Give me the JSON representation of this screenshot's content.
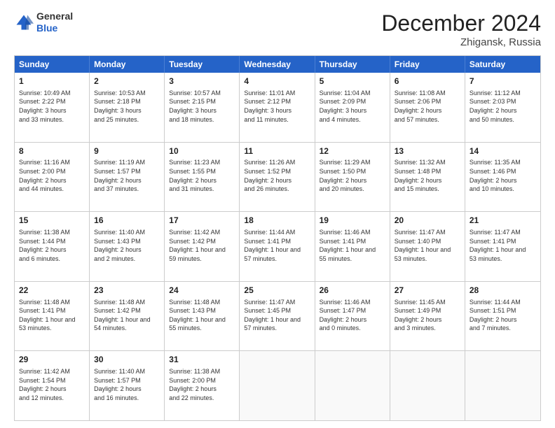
{
  "header": {
    "logo": {
      "line1": "General",
      "line2": "Blue"
    },
    "title": "December 2024",
    "subtitle": "Zhigansk, Russia"
  },
  "calendar": {
    "days_of_week": [
      "Sunday",
      "Monday",
      "Tuesday",
      "Wednesday",
      "Thursday",
      "Friday",
      "Saturday"
    ],
    "weeks": [
      [
        {
          "day": "",
          "empty": true
        },
        {
          "day": "",
          "empty": true
        },
        {
          "day": "",
          "empty": true
        },
        {
          "day": "",
          "empty": true
        },
        {
          "day": "",
          "empty": true
        },
        {
          "day": "",
          "empty": true
        },
        {
          "day": "",
          "empty": true
        }
      ]
    ],
    "cells": [
      [
        {
          "num": "1",
          "lines": [
            "Sunrise: 10:49 AM",
            "Sunset: 2:22 PM",
            "Daylight: 3 hours",
            "and 33 minutes."
          ]
        },
        {
          "num": "2",
          "lines": [
            "Sunrise: 10:53 AM",
            "Sunset: 2:18 PM",
            "Daylight: 3 hours",
            "and 25 minutes."
          ]
        },
        {
          "num": "3",
          "lines": [
            "Sunrise: 10:57 AM",
            "Sunset: 2:15 PM",
            "Daylight: 3 hours",
            "and 18 minutes."
          ]
        },
        {
          "num": "4",
          "lines": [
            "Sunrise: 11:01 AM",
            "Sunset: 2:12 PM",
            "Daylight: 3 hours",
            "and 11 minutes."
          ]
        },
        {
          "num": "5",
          "lines": [
            "Sunrise: 11:04 AM",
            "Sunset: 2:09 PM",
            "Daylight: 3 hours",
            "and 4 minutes."
          ]
        },
        {
          "num": "6",
          "lines": [
            "Sunrise: 11:08 AM",
            "Sunset: 2:06 PM",
            "Daylight: 2 hours",
            "and 57 minutes."
          ]
        },
        {
          "num": "7",
          "lines": [
            "Sunrise: 11:12 AM",
            "Sunset: 2:03 PM",
            "Daylight: 2 hours",
            "and 50 minutes."
          ]
        }
      ],
      [
        {
          "num": "8",
          "lines": [
            "Sunrise: 11:16 AM",
            "Sunset: 2:00 PM",
            "Daylight: 2 hours",
            "and 44 minutes."
          ]
        },
        {
          "num": "9",
          "lines": [
            "Sunrise: 11:19 AM",
            "Sunset: 1:57 PM",
            "Daylight: 2 hours",
            "and 37 minutes."
          ]
        },
        {
          "num": "10",
          "lines": [
            "Sunrise: 11:23 AM",
            "Sunset: 1:55 PM",
            "Daylight: 2 hours",
            "and 31 minutes."
          ]
        },
        {
          "num": "11",
          "lines": [
            "Sunrise: 11:26 AM",
            "Sunset: 1:52 PM",
            "Daylight: 2 hours",
            "and 26 minutes."
          ]
        },
        {
          "num": "12",
          "lines": [
            "Sunrise: 11:29 AM",
            "Sunset: 1:50 PM",
            "Daylight: 2 hours",
            "and 20 minutes."
          ]
        },
        {
          "num": "13",
          "lines": [
            "Sunrise: 11:32 AM",
            "Sunset: 1:48 PM",
            "Daylight: 2 hours",
            "and 15 minutes."
          ]
        },
        {
          "num": "14",
          "lines": [
            "Sunrise: 11:35 AM",
            "Sunset: 1:46 PM",
            "Daylight: 2 hours",
            "and 10 minutes."
          ]
        }
      ],
      [
        {
          "num": "15",
          "lines": [
            "Sunrise: 11:38 AM",
            "Sunset: 1:44 PM",
            "Daylight: 2 hours",
            "and 6 minutes."
          ]
        },
        {
          "num": "16",
          "lines": [
            "Sunrise: 11:40 AM",
            "Sunset: 1:43 PM",
            "Daylight: 2 hours",
            "and 2 minutes."
          ]
        },
        {
          "num": "17",
          "lines": [
            "Sunrise: 11:42 AM",
            "Sunset: 1:42 PM",
            "Daylight: 1 hour and",
            "59 minutes."
          ]
        },
        {
          "num": "18",
          "lines": [
            "Sunrise: 11:44 AM",
            "Sunset: 1:41 PM",
            "Daylight: 1 hour and",
            "57 minutes."
          ]
        },
        {
          "num": "19",
          "lines": [
            "Sunrise: 11:46 AM",
            "Sunset: 1:41 PM",
            "Daylight: 1 hour and",
            "55 minutes."
          ]
        },
        {
          "num": "20",
          "lines": [
            "Sunrise: 11:47 AM",
            "Sunset: 1:40 PM",
            "Daylight: 1 hour and",
            "53 minutes."
          ]
        },
        {
          "num": "21",
          "lines": [
            "Sunrise: 11:47 AM",
            "Sunset: 1:41 PM",
            "Daylight: 1 hour and",
            "53 minutes."
          ]
        }
      ],
      [
        {
          "num": "22",
          "lines": [
            "Sunrise: 11:48 AM",
            "Sunset: 1:41 PM",
            "Daylight: 1 hour and",
            "53 minutes."
          ]
        },
        {
          "num": "23",
          "lines": [
            "Sunrise: 11:48 AM",
            "Sunset: 1:42 PM",
            "Daylight: 1 hour and",
            "54 minutes."
          ]
        },
        {
          "num": "24",
          "lines": [
            "Sunrise: 11:48 AM",
            "Sunset: 1:43 PM",
            "Daylight: 1 hour and",
            "55 minutes."
          ]
        },
        {
          "num": "25",
          "lines": [
            "Sunrise: 11:47 AM",
            "Sunset: 1:45 PM",
            "Daylight: 1 hour and",
            "57 minutes."
          ]
        },
        {
          "num": "26",
          "lines": [
            "Sunrise: 11:46 AM",
            "Sunset: 1:47 PM",
            "Daylight: 2 hours",
            "and 0 minutes."
          ]
        },
        {
          "num": "27",
          "lines": [
            "Sunrise: 11:45 AM",
            "Sunset: 1:49 PM",
            "Daylight: 2 hours",
            "and 3 minutes."
          ]
        },
        {
          "num": "28",
          "lines": [
            "Sunrise: 11:44 AM",
            "Sunset: 1:51 PM",
            "Daylight: 2 hours",
            "and 7 minutes."
          ]
        }
      ],
      [
        {
          "num": "29",
          "lines": [
            "Sunrise: 11:42 AM",
            "Sunset: 1:54 PM",
            "Daylight: 2 hours",
            "and 12 minutes."
          ]
        },
        {
          "num": "30",
          "lines": [
            "Sunrise: 11:40 AM",
            "Sunset: 1:57 PM",
            "Daylight: 2 hours",
            "and 16 minutes."
          ]
        },
        {
          "num": "31",
          "lines": [
            "Sunrise: 11:38 AM",
            "Sunset: 2:00 PM",
            "Daylight: 2 hours",
            "and 22 minutes."
          ]
        },
        {
          "num": "",
          "empty": true,
          "lines": []
        },
        {
          "num": "",
          "empty": true,
          "lines": []
        },
        {
          "num": "",
          "empty": true,
          "lines": []
        },
        {
          "num": "",
          "empty": true,
          "lines": []
        }
      ]
    ]
  }
}
